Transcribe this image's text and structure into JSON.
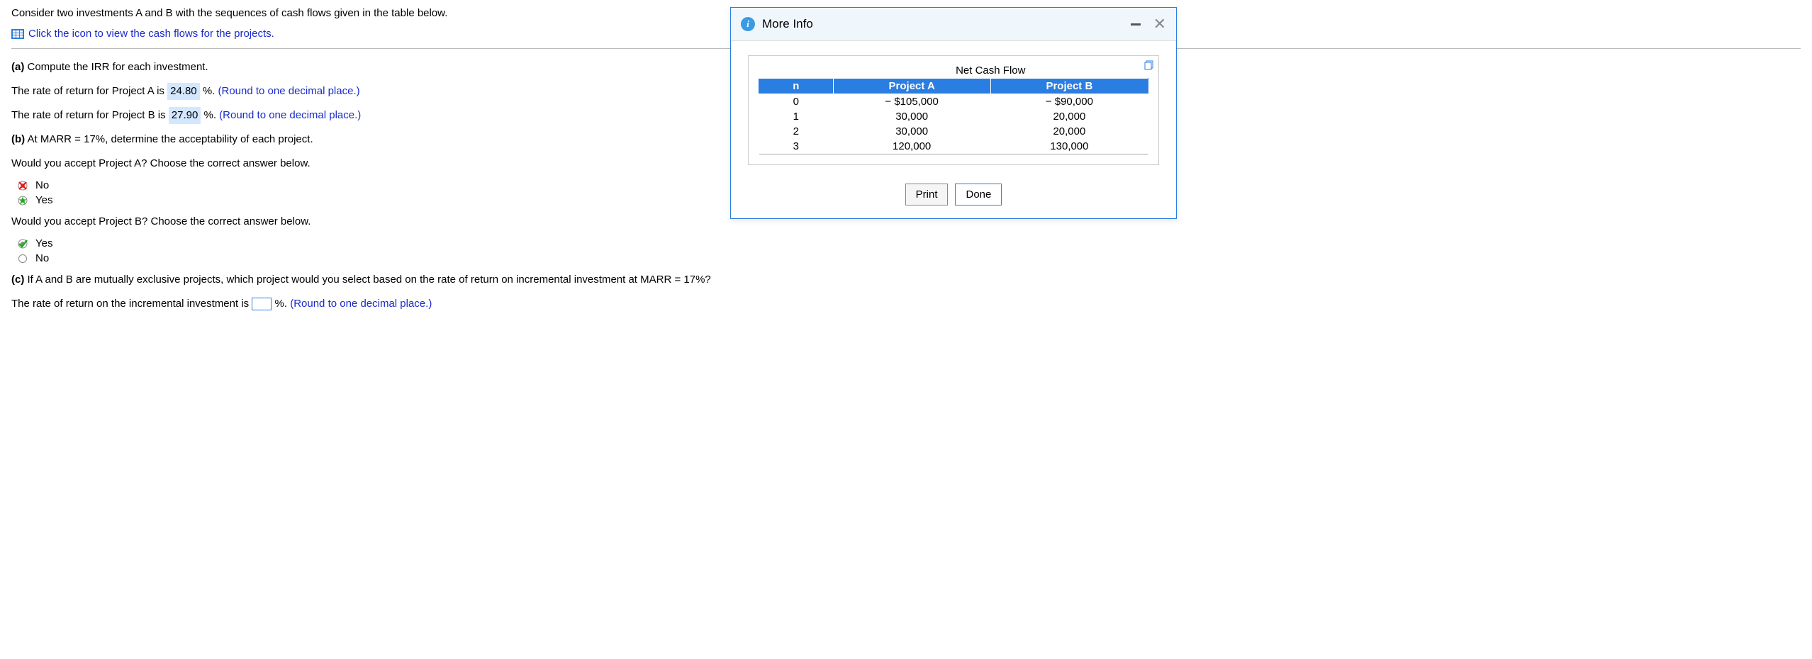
{
  "intro": "Consider two investments A and B with the sequences of cash flows given in the table below.",
  "link_text": "Click the icon to view the cash flows for the projects.",
  "part_a": {
    "label": "(a)",
    "text": " Compute the IRR for each investment.",
    "proj_a_pre": "The rate of return for Project A is ",
    "proj_a_val": "24.80",
    "proj_a_post": " %. ",
    "proj_b_pre": "The rate of return for Project B is ",
    "proj_b_val": "27.90",
    "proj_b_post": " %. ",
    "hint": "(Round to one decimal place.)"
  },
  "part_b": {
    "label": "(b)",
    "text": " At MARR = 17%, determine the acceptability of each project.",
    "q_a": "Would you accept Project A? Choose the correct answer below.",
    "q_b": "Would you accept Project B? Choose the correct answer below.",
    "opt_a1": "No",
    "opt_a2": "Yes",
    "opt_b1": "Yes",
    "opt_b2": "No"
  },
  "part_c": {
    "label": "(c)",
    "text": " If A and B are mutually exclusive projects, which project would you select based on the rate of return on incremental investment at MARR = 17%?",
    "ans_pre": "The rate of return on the incremental investment is ",
    "ans_post": "%. ",
    "hint": "(Round to one decimal place.)"
  },
  "modal": {
    "title": "More Info",
    "table_title": "Net Cash Flow",
    "headers": {
      "n": "n",
      "a": "Project A",
      "b": "Project B"
    },
    "rows": [
      {
        "n": "0",
        "a": "− $105,000",
        "b": "− $90,000"
      },
      {
        "n": "1",
        "a": "30,000",
        "b": "20,000"
      },
      {
        "n": "2",
        "a": "30,000",
        "b": "20,000"
      },
      {
        "n": "3",
        "a": "120,000",
        "b": "130,000"
      }
    ],
    "btn_print": "Print",
    "btn_done": "Done"
  }
}
